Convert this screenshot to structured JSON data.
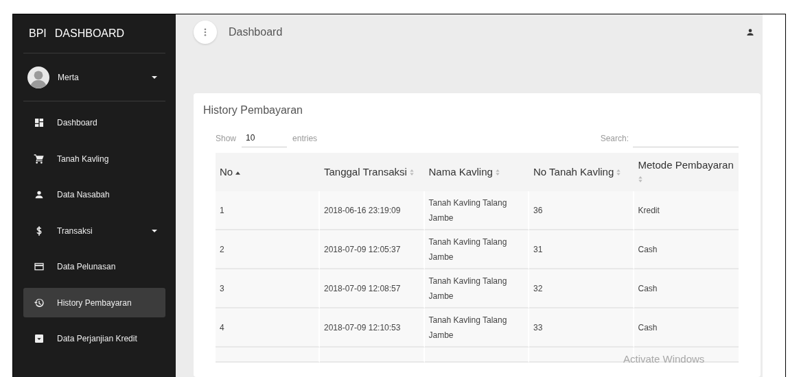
{
  "sidebar": {
    "brand_short": "BPI",
    "brand_title": "DASHBOARD",
    "user": {
      "name": "Merta",
      "expanded": false
    },
    "items": [
      {
        "label": "Dashboard",
        "selected": false,
        "has_submenu": false
      },
      {
        "label": "Tanah Kavling",
        "selected": false,
        "has_submenu": false
      },
      {
        "label": "Data Nasabah",
        "selected": false,
        "has_submenu": false
      },
      {
        "label": "Transaksi",
        "selected": false,
        "has_submenu": true
      },
      {
        "label": "Data Pelunasan",
        "selected": false,
        "has_submenu": false
      },
      {
        "label": "History Pembayaran",
        "selected": true,
        "has_submenu": false
      },
      {
        "label": "Data Perjanjian Kredit",
        "selected": false,
        "has_submenu": false
      }
    ]
  },
  "topbar": {
    "title": "Dashboard"
  },
  "card": {
    "title": "History Pembayaran",
    "length": {
      "label_before": "Show",
      "value": "10",
      "label_after": "entries"
    },
    "search": {
      "label": "Search:"
    },
    "table": {
      "columns": [
        {
          "label": "No",
          "sorted": true
        },
        {
          "label": "Tanggal Transaksi",
          "sorted": false
        },
        {
          "label": "Nama Kavling",
          "sorted": false
        },
        {
          "label": "No Tanah Kavling",
          "sorted": false
        },
        {
          "label": "Metode Pembayaran",
          "sorted": false
        }
      ],
      "rows": [
        [
          "1",
          "2018-06-16 23:19:09",
          "Tanah Kavling Talang Jambe",
          "36",
          "Kredit"
        ],
        [
          "2",
          "2018-07-09 12:05:37",
          "Tanah Kavling Talang Jambe",
          "31",
          "Cash"
        ],
        [
          "3",
          "2018-07-09 12:08:57",
          "Tanah Kavling Talang Jambe",
          "32",
          "Cash"
        ],
        [
          "4",
          "2018-07-09 12:10:53",
          "Tanah Kavling Talang Jambe",
          "33",
          "Cash"
        ]
      ]
    }
  },
  "os_notice": "Activate Windows"
}
